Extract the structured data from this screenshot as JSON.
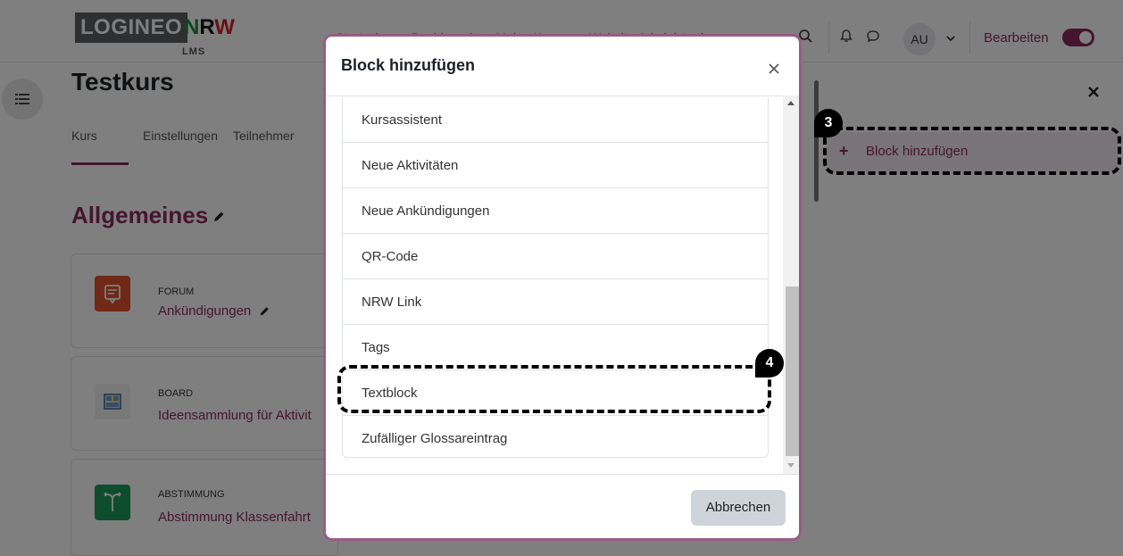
{
  "navbar": {
    "logo_main": "LOGINEO",
    "logo_n": "N",
    "logo_r": "R",
    "logo_w": "W",
    "logo_sub": "LMS",
    "links": [
      "Startseite",
      "Dashboard",
      "Meine Kurse",
      "Website-Administration"
    ],
    "avatar_initials": "AU",
    "edit_mode_label": "Bearbeiten",
    "edit_mode_on": true,
    "accent_color": "#8b2a5c"
  },
  "course": {
    "title": "Testkurs",
    "tabs": [
      "Kurs",
      "Einstellungen",
      "Teilnehmer"
    ],
    "active_tab": "Kurs",
    "section_title": "Allgemeines",
    "activities": [
      {
        "type": "FORUM",
        "name": "Ankündigungen",
        "icon": "forum-icon",
        "color": "#e1502e"
      },
      {
        "type": "BOARD",
        "name": "Ideensammlung für Aktivit",
        "icon": "board-icon",
        "color": "#f0f0f0"
      },
      {
        "type": "ABSTIMMUNG",
        "name": "Abstimmung Klassenfahrt",
        "icon": "choice-icon",
        "color": "#1a9a5c"
      }
    ]
  },
  "block_drawer": {
    "add_block_label": "Block hinzufügen"
  },
  "modal": {
    "title": "Block hinzufügen",
    "items": [
      "Kursassistent",
      "Neue Aktivitäten",
      "Neue Ankündigungen",
      "QR-Code",
      "NRW Link",
      "Tags",
      "Textblock",
      "Zufälliger Glossareintrag"
    ],
    "cancel_label": "Abbrechen"
  },
  "callouts": {
    "step3": "3",
    "step4": "4"
  }
}
